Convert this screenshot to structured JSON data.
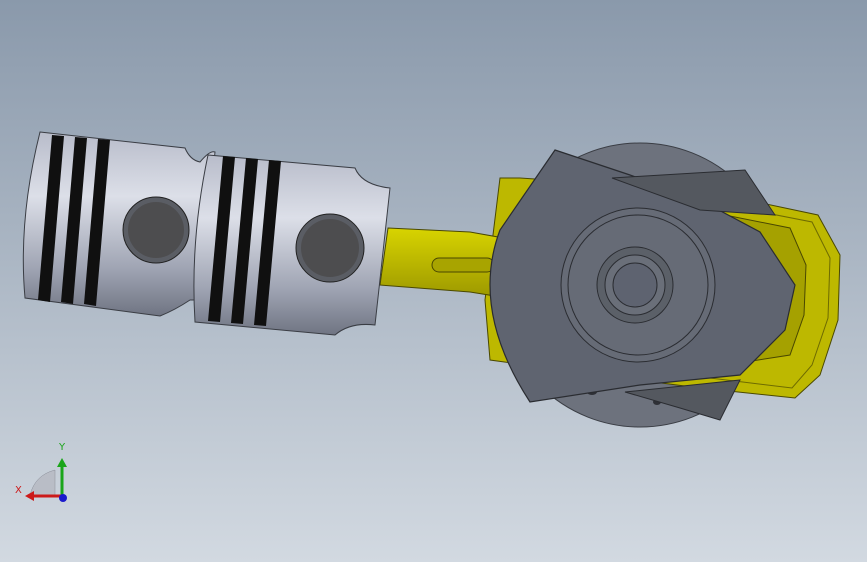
{
  "viewport": {
    "background_top": "#8a99ab",
    "background_bottom": "#d2d9e1"
  },
  "model": {
    "piston_color": "#c9ccd6",
    "ring_groove_color": "#101010",
    "pin_color": "#4d4d4f",
    "rod_color": "#c9c400",
    "crank_web_color": "#5f6470",
    "flywheel_color": "#6d727d"
  },
  "triad": {
    "x_label": "X",
    "y_label": "Y",
    "x_color": "#cc1a1a",
    "y_color": "#1aa51a",
    "z_color": "#1a1acc"
  }
}
